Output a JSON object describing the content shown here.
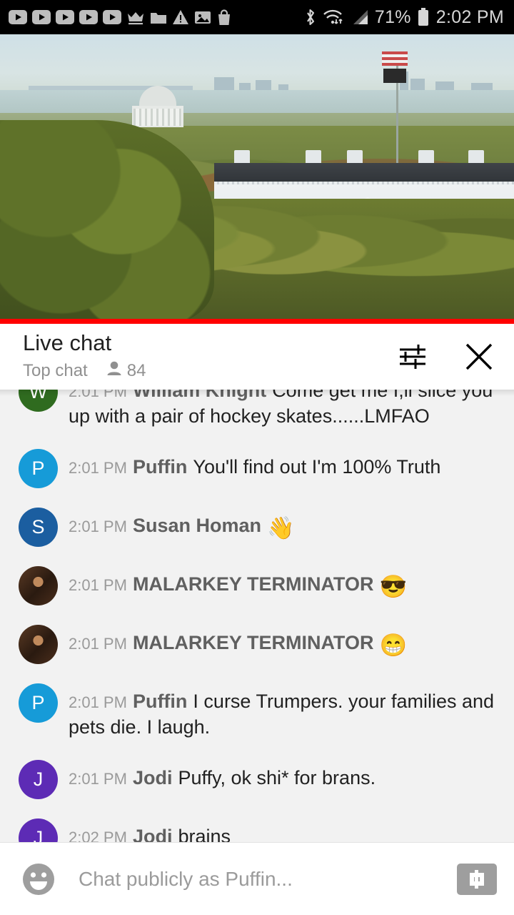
{
  "status_bar": {
    "notification_icons": [
      "youtube-play-icon",
      "youtube-play-icon",
      "youtube-play-icon",
      "youtube-play-icon",
      "youtube-play-icon",
      "crown-icon",
      "folder-icon",
      "warning-triangle-icon",
      "image-icon",
      "shopping-bag-icon"
    ],
    "bluetooth_icon": "bluetooth-icon",
    "wifi_icon": "wifi-icon",
    "signal_icon": "cell-signal-icon",
    "battery_percent": "71%",
    "battery_icon": "battery-icon",
    "time": "2:02 PM"
  },
  "video": {
    "alt": "live-stream-white-house",
    "progress_color": "#ff0000"
  },
  "chat_header": {
    "title": "Live chat",
    "mode": "Top chat",
    "viewer_icon": "person-icon",
    "viewer_count": "84",
    "settings_icon": "tune-sliders-icon",
    "close_icon": "close-x-icon"
  },
  "messages": [
    {
      "avatar_letter": "W",
      "avatar_color": "#2f6b1f",
      "avatar_type": "letter",
      "timestamp": "2:01 PM",
      "author": "William Knight",
      "text": "Come get me I,ll slice you up with a pair of hockey skates......LMFAO",
      "clipped": true
    },
    {
      "avatar_letter": "P",
      "avatar_color": "#169bd8",
      "avatar_type": "letter",
      "timestamp": "2:01 PM",
      "author": "Puffin",
      "text": "You'll find out I'm 100% Truth",
      "clipped": false
    },
    {
      "avatar_letter": "S",
      "avatar_color": "#1b5ea0",
      "avatar_type": "letter",
      "timestamp": "2:01 PM",
      "author": "Susan Homan",
      "text": "👋",
      "clipped": false
    },
    {
      "avatar_letter": "",
      "avatar_color": "#3a2416",
      "avatar_type": "photo",
      "timestamp": "2:01 PM",
      "author": "MALARKEY TERMINATOR",
      "text": "😎",
      "clipped": false
    },
    {
      "avatar_letter": "",
      "avatar_color": "#3a2416",
      "avatar_type": "photo",
      "timestamp": "2:01 PM",
      "author": "MALARKEY TERMINATOR",
      "text": "😁",
      "clipped": false
    },
    {
      "avatar_letter": "P",
      "avatar_color": "#169bd8",
      "avatar_type": "letter",
      "timestamp": "2:01 PM",
      "author": "Puffin",
      "text": "I curse Trumpers. your families and pets die. I laugh.",
      "clipped": false
    },
    {
      "avatar_letter": "J",
      "avatar_color": "#5d2bb5",
      "avatar_type": "letter",
      "timestamp": "2:01 PM",
      "author": "Jodi",
      "text": "Puffy, ok shi* for brans.",
      "clipped": false
    },
    {
      "avatar_letter": "J",
      "avatar_color": "#5d2bb5",
      "avatar_type": "letter",
      "timestamp": "2:02 PM",
      "author": "Jodi",
      "text": "brains",
      "clipped": false
    }
  ],
  "composer": {
    "emoji_icon": "emoji-smiley-icon",
    "placeholder": "Chat publicly as Puffin...",
    "value": "",
    "superchat_icon": "dollar-superchat-icon"
  },
  "colors": {
    "chat_background": "#f2f2f2",
    "accent_red": "#ff0000",
    "text_primary": "#212121",
    "text_secondary": "#909090"
  }
}
